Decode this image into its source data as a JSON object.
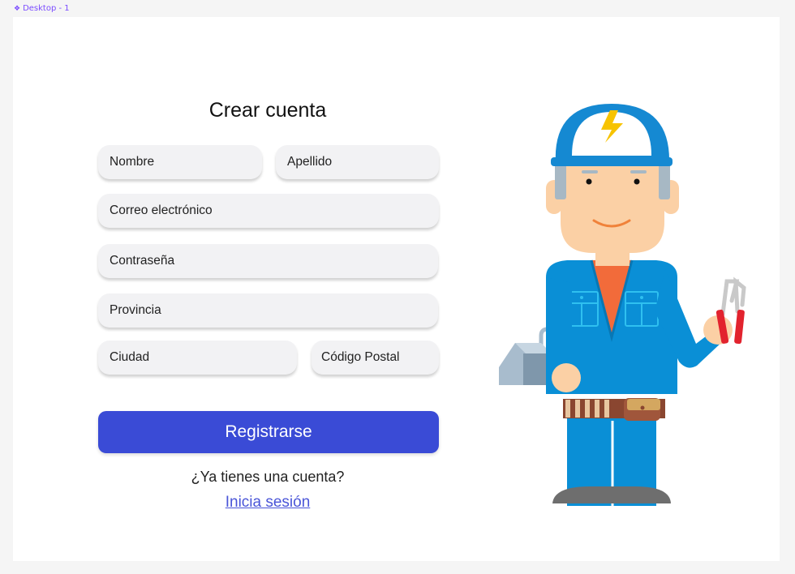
{
  "frame": {
    "icon": "component-diamond-icon",
    "label": "Desktop - 1"
  },
  "form": {
    "title": "Crear cuenta",
    "fields": {
      "first_name": "Nombre",
      "last_name": "Apellido",
      "email": "Correo electrónico",
      "password": "Contraseña",
      "province": "Provincia",
      "city": "Ciudad",
      "postal_code": "Código Postal"
    },
    "submit_label": "Registrarse",
    "have_account_text": "¿Ya tienes una cuenta?",
    "login_link": "Inicia sesión"
  },
  "illustration": {
    "name": "electrician-worker",
    "icon": "lightning-bolt-icon"
  },
  "colors": {
    "accent": "#3a4bd6",
    "link": "#4a55d8",
    "field_bg": "#f2f2f4",
    "worker_blue": "#0a8fd6"
  }
}
